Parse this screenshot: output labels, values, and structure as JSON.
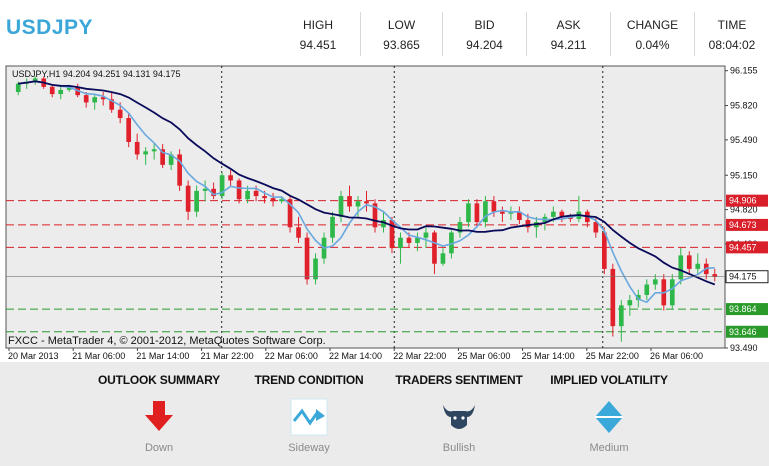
{
  "header": {
    "symbol": "USDJPY",
    "stats": [
      {
        "label": "HIGH",
        "value": "94.451"
      },
      {
        "label": "LOW",
        "value": "93.865"
      },
      {
        "label": "BID",
        "value": "94.204"
      },
      {
        "label": "ASK",
        "value": "94.211"
      },
      {
        "label": "CHANGE",
        "value": "0.04%"
      },
      {
        "label": "TIME",
        "value": "08:04:02"
      }
    ]
  },
  "chart": {
    "info_line": "USDJPY,H1  94.204 94.251 94.131 94.175",
    "copyright": "FXCC - MetaTrader 4, © 2001-2012, MetaQuotes Software Corp.",
    "price_labels": [
      "96.155",
      "95.820",
      "95.490",
      "95.150",
      "94.820",
      "94.490",
      "94.175",
      "93.490"
    ],
    "level_labels": [
      {
        "text": "94.906",
        "color": "#d9202a"
      },
      {
        "text": "94.673",
        "color": "#d9202a"
      },
      {
        "text": "94.457",
        "color": "#d9202a"
      },
      {
        "text": "93.864",
        "color": "#2a9a2a"
      },
      {
        "text": "93.646",
        "color": "#2a9a2a"
      }
    ],
    "current_price_label": "94.175",
    "time_labels": [
      "20 Mar 2013",
      "21 Mar 06:00",
      "21 Mar 14:00",
      "21 Mar 22:00",
      "22 Mar 06:00",
      "22 Mar 14:00",
      "22 Mar 22:00",
      "25 Mar 06:00",
      "25 Mar 14:00",
      "25 Mar 22:00",
      "26 Mar 06:00"
    ]
  },
  "chart_data": {
    "type": "candlestick",
    "symbol": "USDJPY",
    "timeframe": "H1",
    "ylim": [
      93.49,
      96.2
    ],
    "resistance_levels": [
      94.906,
      94.673,
      94.457
    ],
    "support_levels": [
      93.864,
      93.646
    ],
    "current_price": 94.175,
    "candles": [
      [
        95.95,
        96.05,
        95.92,
        96.03
      ],
      [
        96.03,
        96.08,
        95.98,
        96.05
      ],
      [
        96.05,
        96.1,
        96.02,
        96.08
      ],
      [
        96.08,
        96.1,
        95.98,
        96.0
      ],
      [
        96.0,
        96.02,
        95.9,
        95.93
      ],
      [
        95.93,
        96.0,
        95.88,
        95.97
      ],
      [
        95.97,
        96.02,
        95.95,
        96.0
      ],
      [
        96.0,
        96.03,
        95.9,
        95.92
      ],
      [
        95.92,
        95.95,
        95.8,
        95.85
      ],
      [
        95.85,
        95.92,
        95.78,
        95.9
      ],
      [
        95.9,
        95.95,
        95.82,
        95.88
      ],
      [
        95.88,
        95.95,
        95.75,
        95.78
      ],
      [
        95.78,
        95.85,
        95.65,
        95.7
      ],
      [
        95.7,
        95.75,
        95.42,
        95.47
      ],
      [
        95.47,
        95.55,
        95.3,
        95.35
      ],
      [
        95.35,
        95.42,
        95.25,
        95.38
      ],
      [
        95.38,
        95.45,
        95.3,
        95.4
      ],
      [
        95.4,
        95.45,
        95.22,
        95.25
      ],
      [
        95.25,
        95.38,
        95.2,
        95.35
      ],
      [
        95.35,
        95.4,
        95.0,
        95.05
      ],
      [
        95.05,
        95.1,
        94.72,
        94.8
      ],
      [
        94.8,
        95.05,
        94.75,
        95.0
      ],
      [
        95.0,
        95.1,
        94.9,
        95.02
      ],
      [
        95.02,
        95.08,
        94.92,
        94.95
      ],
      [
        94.95,
        95.18,
        94.92,
        95.15
      ],
      [
        95.15,
        95.2,
        95.05,
        95.1
      ],
      [
        95.1,
        95.12,
        94.88,
        94.92
      ],
      [
        94.92,
        95.05,
        94.88,
        95.0
      ],
      [
        95.0,
        95.05,
        94.9,
        94.95
      ],
      [
        94.95,
        95.0,
        94.88,
        94.93
      ],
      [
        94.93,
        94.98,
        94.85,
        94.9
      ],
      [
        94.9,
        94.95,
        94.88,
        94.92
      ],
      [
        94.92,
        94.96,
        94.6,
        94.65
      ],
      [
        94.65,
        94.75,
        94.5,
        94.55
      ],
      [
        94.55,
        94.6,
        94.1,
        94.15
      ],
      [
        94.15,
        94.4,
        94.1,
        94.35
      ],
      [
        94.35,
        94.6,
        94.3,
        94.55
      ],
      [
        94.55,
        94.8,
        94.5,
        94.75
      ],
      [
        94.75,
        95.0,
        94.7,
        94.95
      ],
      [
        94.95,
        95.05,
        94.8,
        94.85
      ],
      [
        94.85,
        94.95,
        94.75,
        94.9
      ],
      [
        94.9,
        95.0,
        94.8,
        94.88
      ],
      [
        94.88,
        94.92,
        94.6,
        94.65
      ],
      [
        94.65,
        94.8,
        94.6,
        94.72
      ],
      [
        94.72,
        94.75,
        94.4,
        94.45
      ],
      [
        94.45,
        94.6,
        94.3,
        94.55
      ],
      [
        94.55,
        94.6,
        94.45,
        94.5
      ],
      [
        94.5,
        94.6,
        94.42,
        94.55
      ],
      [
        94.55,
        94.65,
        94.45,
        94.6
      ],
      [
        94.6,
        94.62,
        94.2,
        94.3
      ],
      [
        94.3,
        94.45,
        94.28,
        94.4
      ],
      [
        94.4,
        94.62,
        94.35,
        94.6
      ],
      [
        94.6,
        94.75,
        94.55,
        94.7
      ],
      [
        94.7,
        94.92,
        94.65,
        94.88
      ],
      [
        94.88,
        94.92,
        94.65,
        94.7
      ],
      [
        94.7,
        94.95,
        94.65,
        94.9
      ],
      [
        94.9,
        94.95,
        94.75,
        94.8
      ],
      [
        94.8,
        94.85,
        94.7,
        94.78
      ],
      [
        94.78,
        94.85,
        94.72,
        94.8
      ],
      [
        94.8,
        94.85,
        94.68,
        94.72
      ],
      [
        94.72,
        94.78,
        94.6,
        94.65
      ],
      [
        94.65,
        94.75,
        94.55,
        94.7
      ],
      [
        94.7,
        94.78,
        94.62,
        94.75
      ],
      [
        94.75,
        94.85,
        94.7,
        94.8
      ],
      [
        94.8,
        94.82,
        94.7,
        94.75
      ],
      [
        94.75,
        94.78,
        94.7,
        94.73
      ],
      [
        94.73,
        94.95,
        94.7,
        94.8
      ],
      [
        94.8,
        94.82,
        94.65,
        94.7
      ],
      [
        94.7,
        94.75,
        94.55,
        94.6
      ],
      [
        94.6,
        94.65,
        94.2,
        94.25
      ],
      [
        94.25,
        94.3,
        93.6,
        93.7
      ],
      [
        93.7,
        93.95,
        93.55,
        93.9
      ],
      [
        93.9,
        94.0,
        93.8,
        93.95
      ],
      [
        93.95,
        94.05,
        93.88,
        94.0
      ],
      [
        94.0,
        94.15,
        93.95,
        94.1
      ],
      [
        94.1,
        94.2,
        94.05,
        94.15
      ],
      [
        94.15,
        94.2,
        93.85,
        93.9
      ],
      [
        93.9,
        94.2,
        93.86,
        94.15
      ],
      [
        94.15,
        94.45,
        94.1,
        94.38
      ],
      [
        94.38,
        94.42,
        94.2,
        94.25
      ],
      [
        94.25,
        94.4,
        94.2,
        94.3
      ],
      [
        94.3,
        94.35,
        94.15,
        94.2
      ],
      [
        94.2,
        94.25,
        94.13,
        94.175
      ]
    ]
  },
  "summary": [
    {
      "title": "OUTLOOK SUMMARY",
      "value": "Down",
      "icon": "arrow-down-icon",
      "color": "#e02020"
    },
    {
      "title": "TREND CONDITION",
      "value": "Sideway",
      "icon": "sideway-trend-icon",
      "color": "#3aa8d8"
    },
    {
      "title": "TRADERS SENTIMENT",
      "value": "Bullish",
      "icon": "bull-icon",
      "color": "#2f4660"
    },
    {
      "title": "IMPLIED VOLATILITY",
      "value": "Medium",
      "icon": "diamond-icon",
      "color": "#3aa8d8"
    }
  ]
}
